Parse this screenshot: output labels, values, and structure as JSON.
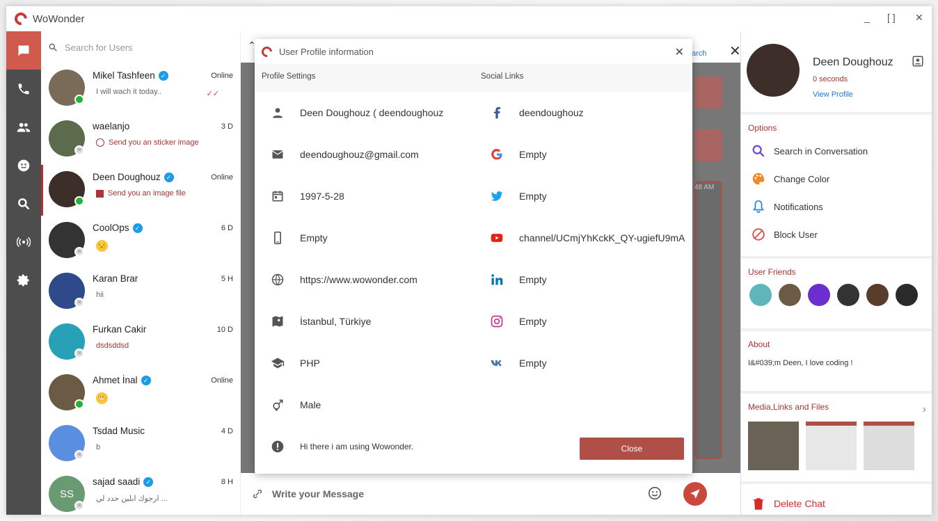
{
  "app": {
    "title": "WoWonder",
    "minimize": "_",
    "maximize": "[ ]",
    "close": "✕"
  },
  "search": {
    "placeholder": "Search for Users"
  },
  "chats": [
    {
      "name": "Mikel Tashfeen",
      "verified": true,
      "time": "Online",
      "online": true,
      "preview": "I will wach it today..",
      "preview_icon": "double-check-icon",
      "avatar_color": "#7a6a58"
    },
    {
      "name": "waelanjo",
      "verified": false,
      "time": "3 D",
      "online": false,
      "preview": "Send you an sticker image",
      "preview_icon": "sticker-icon",
      "avatar_color": "#5d6b4d"
    },
    {
      "name": "Deen Doughouz",
      "verified": true,
      "time": "Online",
      "online": true,
      "preview": "Send you an image file",
      "preview_icon": "image-icon",
      "avatar_color": "#3d2e2a",
      "selected": true
    },
    {
      "name": "CoolOps",
      "verified": true,
      "time": "6 D",
      "online": false,
      "preview": "😒",
      "preview_icon": "emoji",
      "avatar_color": "#333"
    },
    {
      "name": "Karan Brar",
      "verified": false,
      "time": "5 H",
      "online": false,
      "preview": "hii",
      "preview_icon": "",
      "avatar_color": "#2f4a8a"
    },
    {
      "name": "Furkan Cakir",
      "verified": false,
      "time": "10 D",
      "online": false,
      "preview": "dsdsddsd",
      "preview_icon": "",
      "avatar_color": "#27a0b8"
    },
    {
      "name": "Ahmet İnal",
      "verified": true,
      "time": "Online",
      "online": true,
      "preview": "😬",
      "preview_icon": "emoji",
      "avatar_color": "#6b5a44"
    },
    {
      "name": "Tsdad Music",
      "verified": false,
      "time": "4 D",
      "online": false,
      "preview": "b",
      "preview_icon": "",
      "avatar_color": "#5a8fe0"
    },
    {
      "name": "sajad saadi",
      "verified": true,
      "time": "8 H",
      "online": false,
      "preview": "ارجوك ابلين حدد لي ...",
      "preview_icon": "",
      "avatar_color": "#6a9a72",
      "initials": "SS"
    }
  ],
  "composer": {
    "placeholder": "Write your Message"
  },
  "modal": {
    "title": "User Profile information",
    "profile_header": "Profile Settings",
    "social_header": "Social Links",
    "profile": [
      {
        "icon": "person-icon",
        "value": "Deen Doughouz ( deendoughouz"
      },
      {
        "icon": "email-icon",
        "value": "deendoughouz@gmail.com"
      },
      {
        "icon": "calendar-icon",
        "value": "1997-5-28"
      },
      {
        "icon": "phone-icon",
        "value": "Empty"
      },
      {
        "icon": "globe-icon",
        "value": "https://www.wowonder.com"
      },
      {
        "icon": "map-icon",
        "value": "İstanbul, Türkiye"
      },
      {
        "icon": "school-icon",
        "value": "PHP"
      },
      {
        "icon": "gender-icon",
        "value": "Male"
      },
      {
        "icon": "info-icon",
        "value": "Hi there i am using Wowonder."
      }
    ],
    "social": [
      {
        "icon": "facebook-icon",
        "value": "deendoughouz"
      },
      {
        "icon": "google-icon",
        "value": "Empty"
      },
      {
        "icon": "twitter-icon",
        "value": "Empty"
      },
      {
        "icon": "youtube-icon",
        "value": "channel/UCmjYhKckK_QY-ugiefU9mA"
      },
      {
        "icon": "linkedin-icon",
        "value": "Empty"
      },
      {
        "icon": "instagram-icon",
        "value": "Empty"
      },
      {
        "icon": "vk-icon",
        "value": "Empty"
      }
    ],
    "close_label": "Close"
  },
  "right": {
    "name": "Deen Doughouz",
    "last_seen": "0 seconds",
    "view_profile": "View Profile",
    "options_header": "Options",
    "options": [
      {
        "icon": "search-icon",
        "label": "Search in Conversation",
        "color": "#6a4fd6"
      },
      {
        "icon": "palette-icon",
        "label": "Change Color",
        "color": "#f08a24"
      },
      {
        "icon": "bell-icon",
        "label": "Notifications",
        "color": "#2f8de0"
      },
      {
        "icon": "block-icon",
        "label": "Block User",
        "color": "#e34b4b"
      }
    ],
    "friends_header": "User Friends",
    "friend_colors": [
      "#5fb6b8",
      "#6b5a44",
      "#6b2fd0",
      "#333",
      "#5a3c2c",
      "#2a2a2a"
    ],
    "about_header": "About",
    "about_text": "I&#039;m Deen, I love coding !",
    "media_header": "Media,Links and Files",
    "delete_label": "Delete Chat"
  },
  "partial_text": {
    "search_fragment": "arch",
    "time_fragment": "48 AM"
  }
}
